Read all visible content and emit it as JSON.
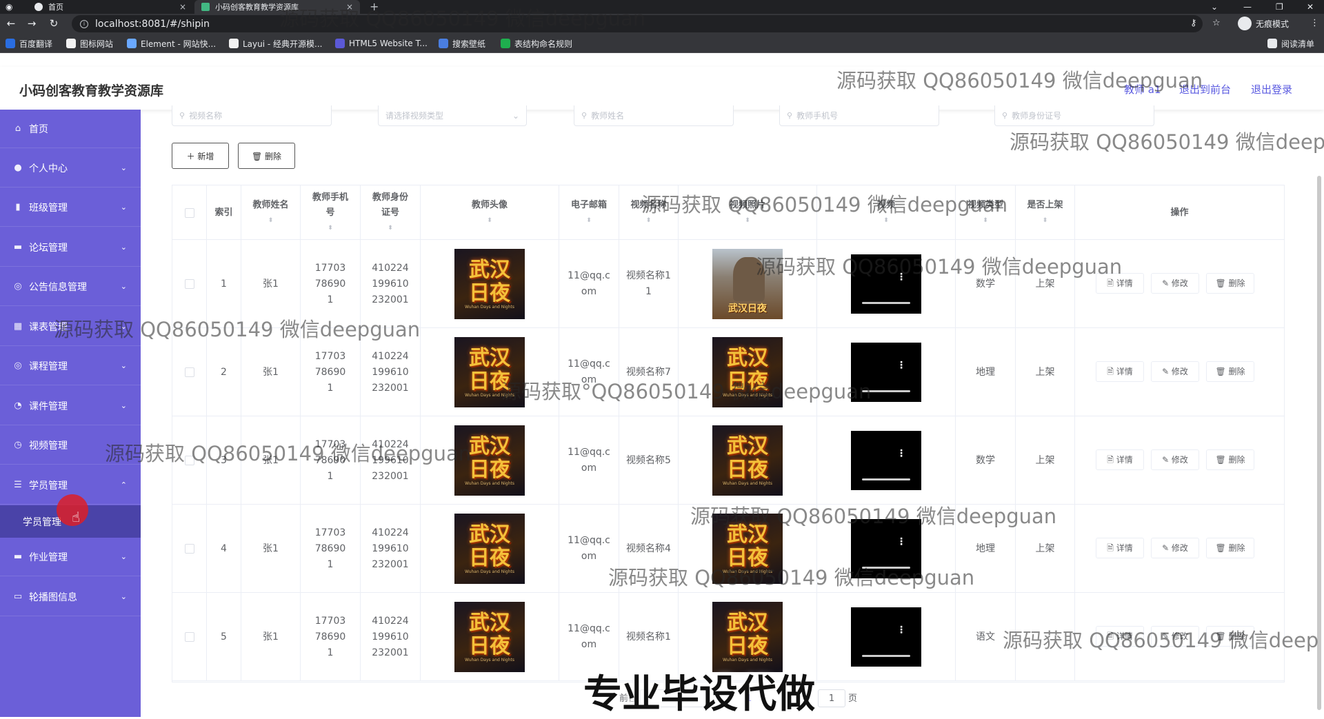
{
  "browser": {
    "tabs": [
      {
        "title": "首页",
        "close": "×"
      },
      {
        "title": "小码创客教育教学资源库",
        "close": "×"
      }
    ],
    "new_tab": "+",
    "window_controls": [
      "⌄",
      "—",
      "❐",
      "✕"
    ],
    "nav": {
      "back": "←",
      "forward": "→",
      "reload": "↻"
    },
    "url": "localhost:8081/#/shipin",
    "key_icon": "⚷",
    "star_icon": "☆",
    "incognito_label": "无痕模式",
    "menu_icon": "⋮",
    "bookmarks": [
      "百度翻译",
      "图标网站",
      "Element - 网站快...",
      "Layui - 经典开源模...",
      "HTML5 Website T...",
      "搜索壁纸",
      "表结构命名规则"
    ],
    "reading_list": "阅读清单",
    "bookmark_colors": [
      "#2a6de0",
      "#f2f2f2",
      "#6aa8ff",
      "#f2f2f2",
      "#5b59d6",
      "#4a7ee0",
      "#1fae4e"
    ]
  },
  "header": {
    "title": "小码创客教育教学资源库",
    "user_label": "教师 a1",
    "back_to_front": "退出到前台",
    "logout": "退出登录"
  },
  "sidebar": {
    "items": [
      {
        "label": "首页",
        "icon": "⌂",
        "arrow": ""
      },
      {
        "label": "个人中心",
        "icon": "●",
        "arrow": "⌄"
      },
      {
        "label": "班级管理",
        "icon": "▮",
        "arrow": "⌄"
      },
      {
        "label": "论坛管理",
        "icon": "▬",
        "arrow": "⌄"
      },
      {
        "label": "公告信息管理",
        "icon": "◎",
        "arrow": "⌄"
      },
      {
        "label": "课表管理",
        "icon": "▦",
        "arrow": "⌄"
      },
      {
        "label": "课程管理",
        "icon": "◎",
        "arrow": "⌄"
      },
      {
        "label": "课件管理",
        "icon": "◔",
        "arrow": "⌄"
      },
      {
        "label": "视频管理",
        "icon": "◷",
        "arrow": ""
      },
      {
        "label": "学员管理",
        "icon": "☰",
        "arrow": "⌃"
      },
      {
        "label": "作业管理",
        "icon": "▬",
        "arrow": "⌄"
      },
      {
        "label": "轮播图信息",
        "icon": "▭",
        "arrow": "⌄"
      }
    ],
    "submenu_label": "学员管理"
  },
  "search": {
    "video_name": "视频名称",
    "video_type": "请选择视频类型",
    "teacher_name": "教师姓名",
    "teacher_phone": "教师手机号",
    "teacher_id": "教师身份证号"
  },
  "toolbar": {
    "add": "＋ 新增",
    "delete": "🗑 删除"
  },
  "table": {
    "headers": {
      "index": "索引",
      "teacher_name": "教师姓名",
      "teacher_phone": "教师手机号",
      "teacher_id": "教师身份证号",
      "avatar": "教师头像",
      "email": "电子邮箱",
      "video_name": "视频名称",
      "video_image": "视频照片",
      "video": "视频",
      "video_type": "视频类型",
      "on_shelf": "是否上架",
      "actions": "操作"
    },
    "sort_icon": "⬍",
    "rows": [
      {
        "index": "1",
        "name": "张1",
        "phone": "17703786901",
        "id": "410224199610232001",
        "email": "11@qq.com",
        "video_name": "视频名称11",
        "type": "数学",
        "shelf": "上架"
      },
      {
        "index": "2",
        "name": "张1",
        "phone": "17703786901",
        "id": "410224199610232001",
        "email": "11@qq.com",
        "video_name": "视频名称7",
        "type": "地理",
        "shelf": "上架"
      },
      {
        "index": "3",
        "name": "张1",
        "phone": "17703786901",
        "id": "410224199610232001",
        "email": "11@qq.com",
        "video_name": "视频名称5",
        "type": "数学",
        "shelf": "上架"
      },
      {
        "index": "4",
        "name": "张1",
        "phone": "17703786901",
        "id": "410224199610232001",
        "email": "11@qq.com",
        "video_name": "视频名称4",
        "type": "地理",
        "shelf": "上架"
      },
      {
        "index": "5",
        "name": "张1",
        "phone": "17703786901",
        "id": "410224199610232001",
        "email": "11@qq.com",
        "video_name": "视频名称1",
        "type": "语文",
        "shelf": ""
      }
    ],
    "actions": {
      "detail": "🗎 详情",
      "edit": "✎ 修改",
      "delete": "🗑 删除"
    },
    "poster_title": "武汉日夜",
    "poster_sub": "Wuhan Days and Nights",
    "alt_poster_title": "武汉日夜"
  },
  "pagination": {
    "goto_prefix": "前往",
    "page_input": "1",
    "page_suffix": "页",
    "page_num": "1"
  },
  "overlay": {
    "watermark": "源码获取 QQ86050149 微信deepguan",
    "watermark_alt": "源码获取°QQ86050149 微信deepguan",
    "watermark_partial": "源码获取 QQ86050149 微信deep",
    "banner": "专业毕设代做"
  },
  "colors": {
    "sidebar": "#6b5fd8",
    "submenu": "#4a43a8",
    "accent": "#5a5ae0"
  }
}
